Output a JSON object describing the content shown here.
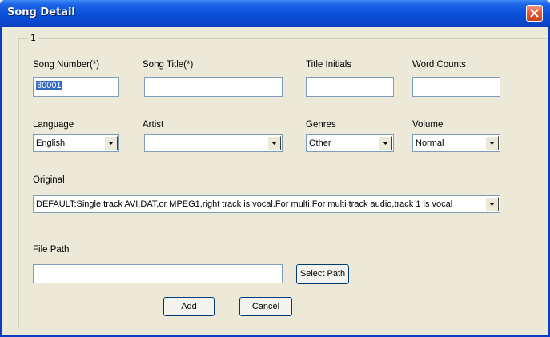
{
  "window": {
    "title": "Song Detail"
  },
  "group": {
    "label": "1"
  },
  "fields": {
    "song_number": {
      "label": "Song Number(*)",
      "value": "80001"
    },
    "song_title": {
      "label": "Song Title(*)",
      "value": ""
    },
    "title_initials": {
      "label": "Title Initials",
      "value": ""
    },
    "word_counts": {
      "label": "Word Counts",
      "value": ""
    },
    "language": {
      "label": "Language",
      "value": "English"
    },
    "artist": {
      "label": "Artist",
      "value": ""
    },
    "genres": {
      "label": "Genres",
      "value": "Other"
    },
    "volume": {
      "label": "Volume",
      "value": "Normal"
    },
    "original": {
      "label": "Original",
      "value": "DEFAULT:Single track AVI,DAT,or MPEG1,right track is vocal.For multi.For multi track audio,track 1 is vocal"
    },
    "file_path": {
      "label": "File Path",
      "value": ""
    }
  },
  "buttons": {
    "select_path": "Select Path",
    "add": "Add",
    "cancel": "Cancel"
  },
  "icons": {
    "close": "close-icon",
    "dropdown": "chevron-down-icon"
  },
  "colors": {
    "titlebar": "#0a4fd8",
    "close": "#e45a35",
    "face": "#ece9d8",
    "field_border": "#7f9db9",
    "selection": "#316ac5"
  }
}
